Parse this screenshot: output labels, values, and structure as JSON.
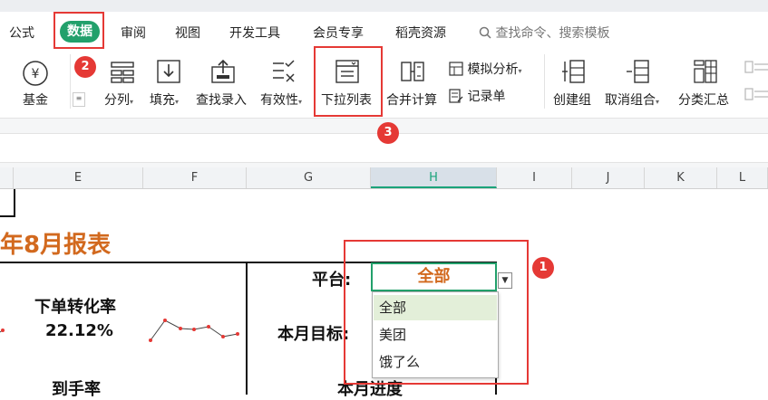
{
  "menu": {
    "formula": "公式",
    "data": "数据",
    "review": "审阅",
    "view": "视图",
    "dev_tools": "开发工具",
    "member": "会员专享",
    "resources": "稻壳资源",
    "search_placeholder": "查找命令、搜索模板"
  },
  "ribbon": {
    "fund": "基金",
    "split_column": "分列",
    "fill": "填充",
    "lookup_entry": "查找录入",
    "validity": "有效性",
    "dropdown_list": "下拉列表",
    "merge_calc": "合并计算",
    "simulate": "模拟分析",
    "record": "记录单",
    "create_group": "创建组",
    "ungroup": "取消组合",
    "subtotal": "分类汇总"
  },
  "badges": {
    "b1": "1",
    "b2": "2",
    "b3": "3"
  },
  "columns": [
    "E",
    "F",
    "G",
    "H",
    "I",
    "J",
    "K",
    "L"
  ],
  "sheet": {
    "title": "年8月报表",
    "order_conversion_label": "下单转化率",
    "order_conversion_value": "22.12%",
    "arrival_rate_label": "到手率",
    "platform_label": "平台:",
    "monthly_target_label": "本月目标:",
    "monthly_progress_label": "本月进度"
  },
  "dropdown": {
    "selected": "全部",
    "options": [
      "全部",
      "美团",
      "饿了么"
    ]
  },
  "colors": {
    "accent": "#22a06b",
    "highlight": "#e53935",
    "title": "#d2691e"
  }
}
